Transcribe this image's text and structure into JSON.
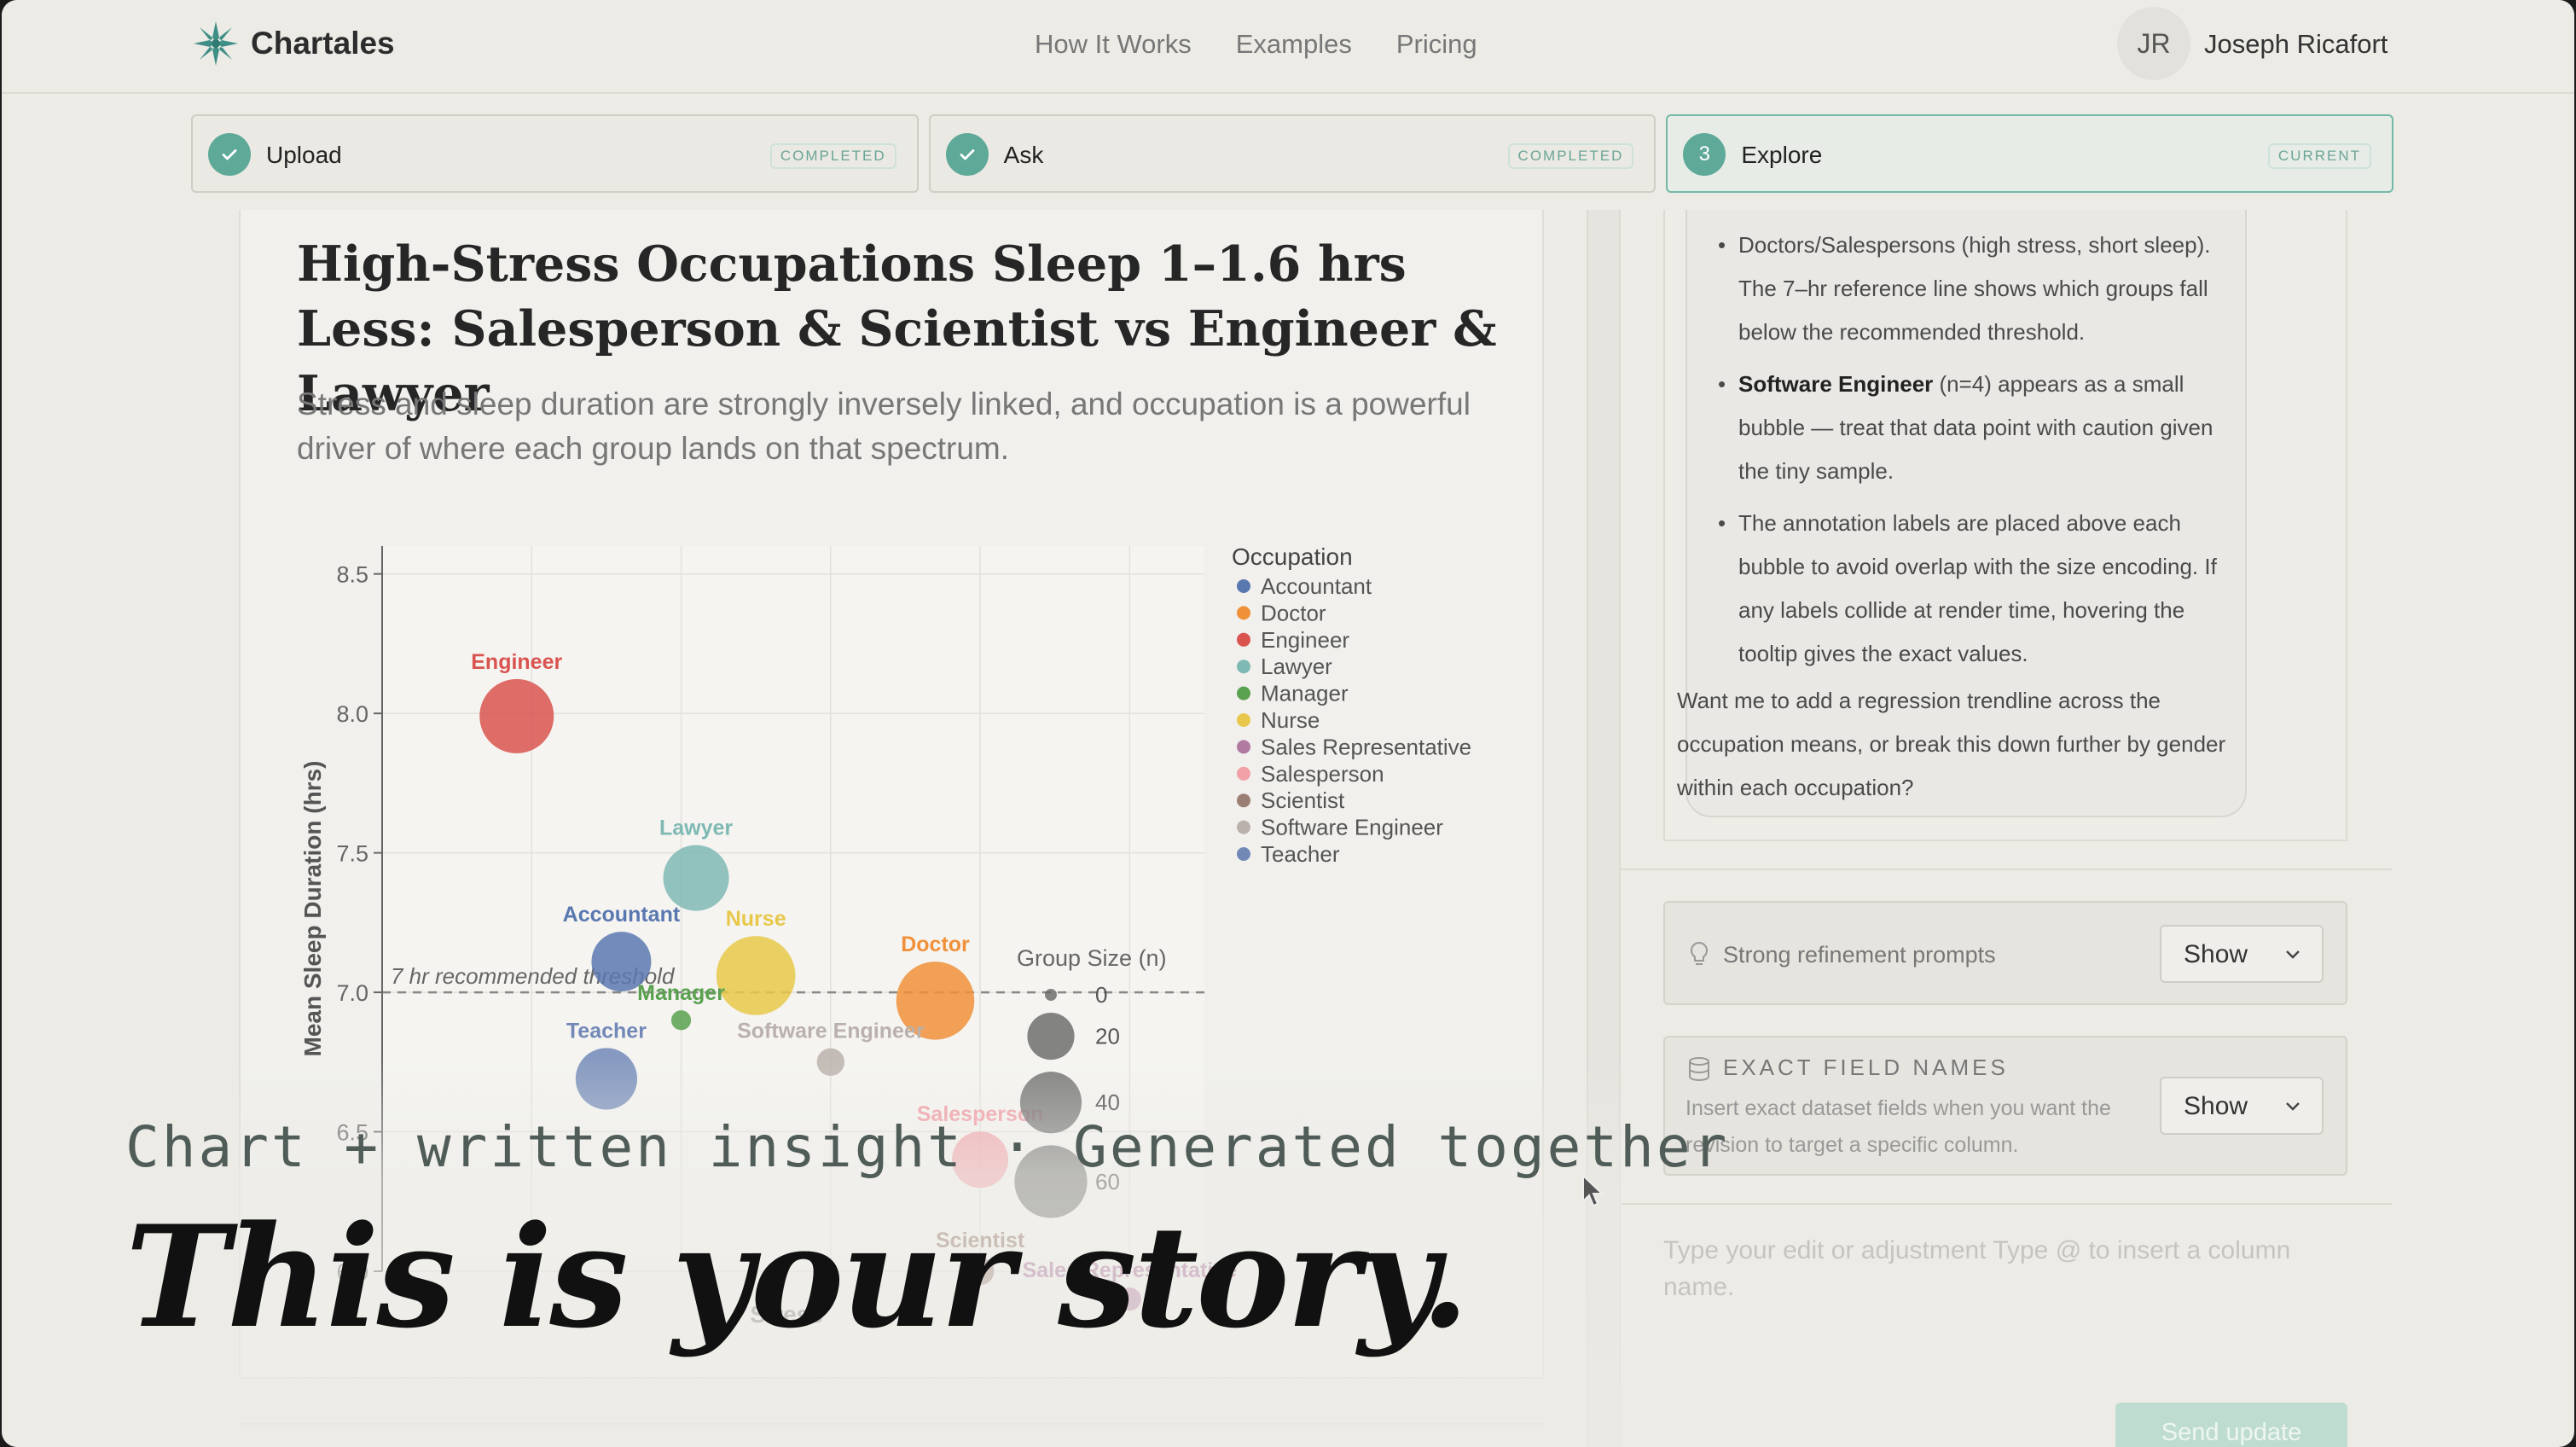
{
  "nav": {
    "brand": "Chartales",
    "links": [
      "How It Works",
      "Examples",
      "Pricing"
    ],
    "user_initials": "JR",
    "user_name": "Joseph Ricafort"
  },
  "steps": [
    {
      "label": "Upload",
      "status": "COMPLETED"
    },
    {
      "label": "Ask",
      "status": "COMPLETED"
    },
    {
      "label": "Explore",
      "status": "CURRENT",
      "number": "3"
    }
  ],
  "story": {
    "title": "High-Stress Occupations Sleep 1–1.6 hrs Less: Salesperson & Scientist vs Engineer & Lawyer",
    "subtitle": "Stress and sleep duration are strongly inversely linked, and occupation is a powerful driver of where each group lands on that spectrum."
  },
  "chart_data": {
    "type": "scatter",
    "title": "",
    "xlabel": "Stress",
    "ylabel": "Mean Sleep Duration (hrs)",
    "ylim": [
      6.0,
      8.6
    ],
    "yticks": [
      "8.5",
      "8.0",
      "7.5",
      "7.0",
      "6.5",
      "6.0"
    ],
    "legend_title": "Occupation",
    "legend": [
      "Accountant",
      "Doctor",
      "Engineer",
      "Lawyer",
      "Manager",
      "Nurse",
      "Sales Representative",
      "Salesperson",
      "Scientist",
      "Software Engineer",
      "Teacher"
    ],
    "size_legend_title": "Group Size (n)",
    "size_legend": [
      "0",
      "20",
      "40",
      "60"
    ],
    "reference_line": {
      "y": 7.0,
      "label": "7 hr recommended threshold"
    },
    "points": [
      {
        "label": "Engineer",
        "x": 3.9,
        "y": 7.99,
        "n": 63,
        "color": "#d9534f"
      },
      {
        "label": "Lawyer",
        "x": 5.1,
        "y": 7.41,
        "n": 47,
        "color": "#7fb9b4"
      },
      {
        "label": "Accountant",
        "x": 4.6,
        "y": 7.11,
        "n": 37,
        "color": "#5a78b0"
      },
      {
        "label": "Nurse",
        "x": 5.5,
        "y": 7.06,
        "n": 73,
        "color": "#e8c84a"
      },
      {
        "label": "Manager",
        "x": 5.0,
        "y": 6.9,
        "n": 1,
        "color": "#59a14f"
      },
      {
        "label": "Doctor",
        "x": 6.7,
        "y": 6.97,
        "n": 71,
        "color": "#f0913a"
      },
      {
        "label": "Software Engineer",
        "x": 6.0,
        "y": 6.75,
        "n": 4,
        "color": "#bab0ac"
      },
      {
        "label": "Teacher",
        "x": 4.5,
        "y": 6.69,
        "n": 40,
        "color": "#7289b8"
      },
      {
        "label": "Salesperson",
        "x": 7.0,
        "y": 6.4,
        "n": 32,
        "color": "#f2a0a8"
      },
      {
        "label": "Scientist",
        "x": 7.0,
        "y": 6.0,
        "n": 4,
        "color": "#9c7f74"
      },
      {
        "label": "Sales Representative",
        "x": 8.0,
        "y": 5.9,
        "n": 2,
        "color": "#b07aa1"
      }
    ]
  },
  "chat": {
    "line1": "Doctors/Salespersons (high stress, short sleep). The 7–hr reference line shows which groups fall below the recommended threshold.",
    "bullet1_bold": "Software Engineer",
    "bullet1_rest": " (n=4) appears as a small bubble — treat that data point with caution given the tiny sample.",
    "bullet2": "The annotation labels are placed above each bubble to avoid overlap with the size encoding. If any labels collide at render time, hovering the tooltip gives the exact values.",
    "closing": "Want me to add a regression trendline across the occupation means, or break this down further by gender within each occupation?"
  },
  "refine": {
    "prompts_label": "Strong refinement prompts",
    "prompts_select": "Show",
    "fields_label": "EXACT FIELD NAMES",
    "fields_desc": "Insert exact dataset fields when you want the revision to target a specific column.",
    "fields_select": "Show",
    "edit_placeholder": "Type your edit or adjustment Type @ to insert a column name.",
    "send_label": "Send update"
  },
  "overlay": {
    "caption": "Chart + written insight · Generated together",
    "headline": "This is your story."
  }
}
